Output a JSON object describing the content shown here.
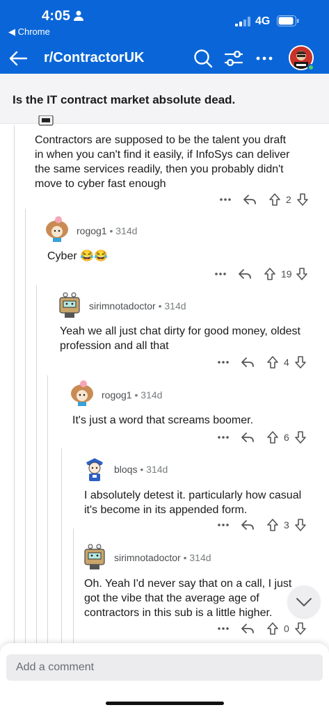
{
  "status_bar": {
    "time": "4:05",
    "back_app": "◀ Chrome",
    "network": "4G"
  },
  "nav": {
    "title": "r/ContractorUK",
    "icons": [
      "back-arrow-icon",
      "search-icon",
      "filter-icon",
      "more-icon",
      "avatar"
    ]
  },
  "post": {
    "title": "Is the IT contract market absolute dead."
  },
  "comments": [
    {
      "text": "Contractors are supposed to be the talent you draft in when you can't find it easily, if InfoSys can deliver the same services readily, then you probably didn't move to cyber fast enough",
      "lines": [
        "Contractors are supposed to be the talent you draft",
        "in when you can't find it easily, if InfoSys can deliver",
        "the same services readily, then you probably didn't",
        "move to cyber fast enough"
      ],
      "votes": "2"
    },
    {
      "username": "rogog1",
      "age": "314d",
      "text": "Cyber",
      "emoji": "😂😂",
      "votes": "19"
    },
    {
      "username": "sirimnotadoctor",
      "age": "314d",
      "lines": [
        "Yeah we all just chat dirty for good money, oldest",
        "profession and all that"
      ],
      "votes": "4"
    },
    {
      "username": "rogog1",
      "age": "314d",
      "lines": [
        "It's just a word that screams boomer."
      ],
      "votes": "6"
    },
    {
      "username": "bloqs",
      "age": "314d",
      "lines": [
        "I absolutely detest it. particularly how casual",
        "it's become in its appended form."
      ],
      "votes": "3"
    },
    {
      "username": "sirimnotadoctor",
      "age": "314d",
      "lines": [
        "Oh. Yeah I'd never say that on a call, I just",
        "got the vibe that the average age of",
        "contractors in this sub is a little higher."
      ],
      "votes": "0"
    }
  ],
  "separator": "•",
  "composer": {
    "placeholder": "Add a comment"
  },
  "colors": {
    "brand_blue": "#0a66d8",
    "meta_grey": "#787c7e",
    "thread_line": "#d6d6da"
  }
}
